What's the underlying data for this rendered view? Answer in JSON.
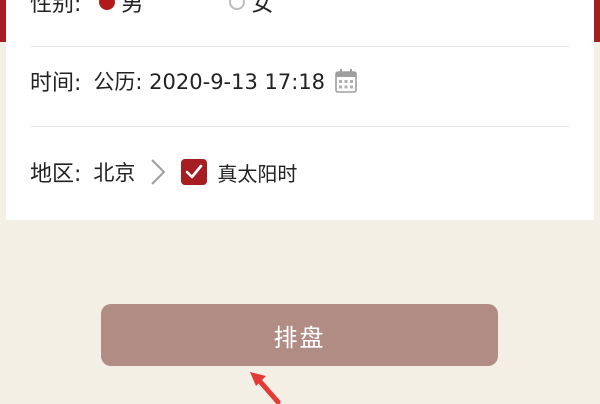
{
  "form": {
    "gender": {
      "label": "性别:",
      "options": [
        {
          "label": "男",
          "selected": true
        },
        {
          "label": "女",
          "selected": false
        }
      ]
    },
    "time": {
      "label": "时间:",
      "value": "公历: 2020-9-13 17:18",
      "icon": "calendar-icon"
    },
    "region": {
      "label": "地区:",
      "value": "北京",
      "icon": "chevron-right-icon",
      "true_solar_time": {
        "label": "真太阳时",
        "checked": true
      }
    }
  },
  "submit": {
    "label": "排盘"
  },
  "colors": {
    "accent": "#a51f21",
    "button": "#b08c84",
    "background": "#f3efe5",
    "annotation_arrow": "#e53935"
  }
}
